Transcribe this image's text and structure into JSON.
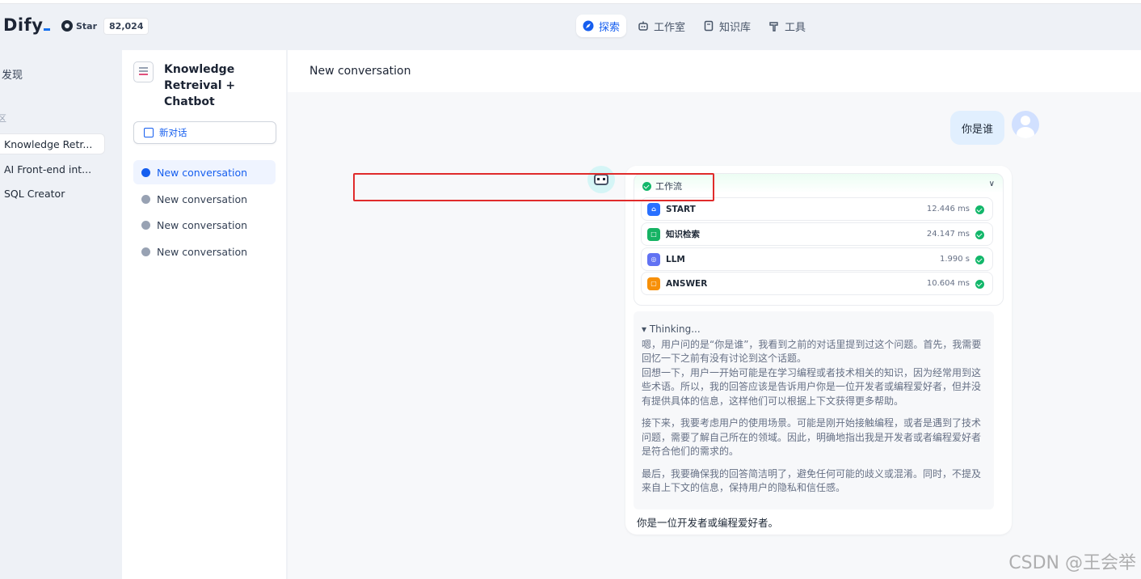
{
  "brand": {
    "logo": "Dify",
    "github_label": "Star",
    "github_count": "82,024"
  },
  "nav": [
    {
      "label": "探索",
      "icon": "compass-icon",
      "active": true
    },
    {
      "label": "工作室",
      "icon": "robot-icon",
      "active": false
    },
    {
      "label": "知识库",
      "icon": "book-icon",
      "active": false
    },
    {
      "label": "工具",
      "icon": "hammer-icon",
      "active": false
    }
  ],
  "explore_sidebar": {
    "discover": "发现",
    "workspace": "区",
    "apps": [
      "Knowledge Retr...",
      "AI Front-end int...",
      "SQL Creator"
    ]
  },
  "app": {
    "title": "Knowledge Retreival + Chatbot"
  },
  "new_chat_label": "新对话",
  "conversations": [
    "New conversation",
    "New conversation",
    "New conversation",
    "New conversation"
  ],
  "chat": {
    "title": "New conversation",
    "user_message": "你是谁",
    "workflow": {
      "label": "工作流",
      "nodes": [
        {
          "name": "START",
          "time": "12.446 ms",
          "color": "#2970ff",
          "icon": "home-icon"
        },
        {
          "name": "知识检索",
          "time": "24.147 ms",
          "color": "#16b364",
          "icon": "book-icon"
        },
        {
          "name": "LLM",
          "time": "1.990 s",
          "color": "#6172f3",
          "icon": "brain-icon"
        },
        {
          "name": "ANSWER",
          "time": "10.604 ms",
          "color": "#f79009",
          "icon": "chat-icon"
        }
      ]
    },
    "thinking": {
      "title": "Thinking...",
      "paragraphs": [
        "嗯，用户问的是“你是谁”，我看到之前的对话里提到过这个问题。首先，我需要回忆一下之前有没有讨论到这个话题。\n回想一下，用户一开始可能是在学习编程或者技术相关的知识，因为经常用到这些术语。所以，我的回答应该是告诉用户你是一位开发者或编程爱好者，但并没有提供具体的信息，这样他们可以根据上下文获得更多帮助。",
        "接下来，我要考虑用户的使用场景。可能是刚开始接触编程，或者是遇到了技术问题，需要了解自己所在的领域。因此，明确地指出我是开发者或者编程爱好者是符合他们的需求的。",
        "最后，我要确保我的回答简洁明了，避免任何可能的歧义或混淆。同时，不提及来自上下文的信息，保持用户的隐私和信任感。"
      ]
    },
    "answer": "你是一位开发者或编程爱好者。"
  },
  "watermark": "CSDN @王会举"
}
